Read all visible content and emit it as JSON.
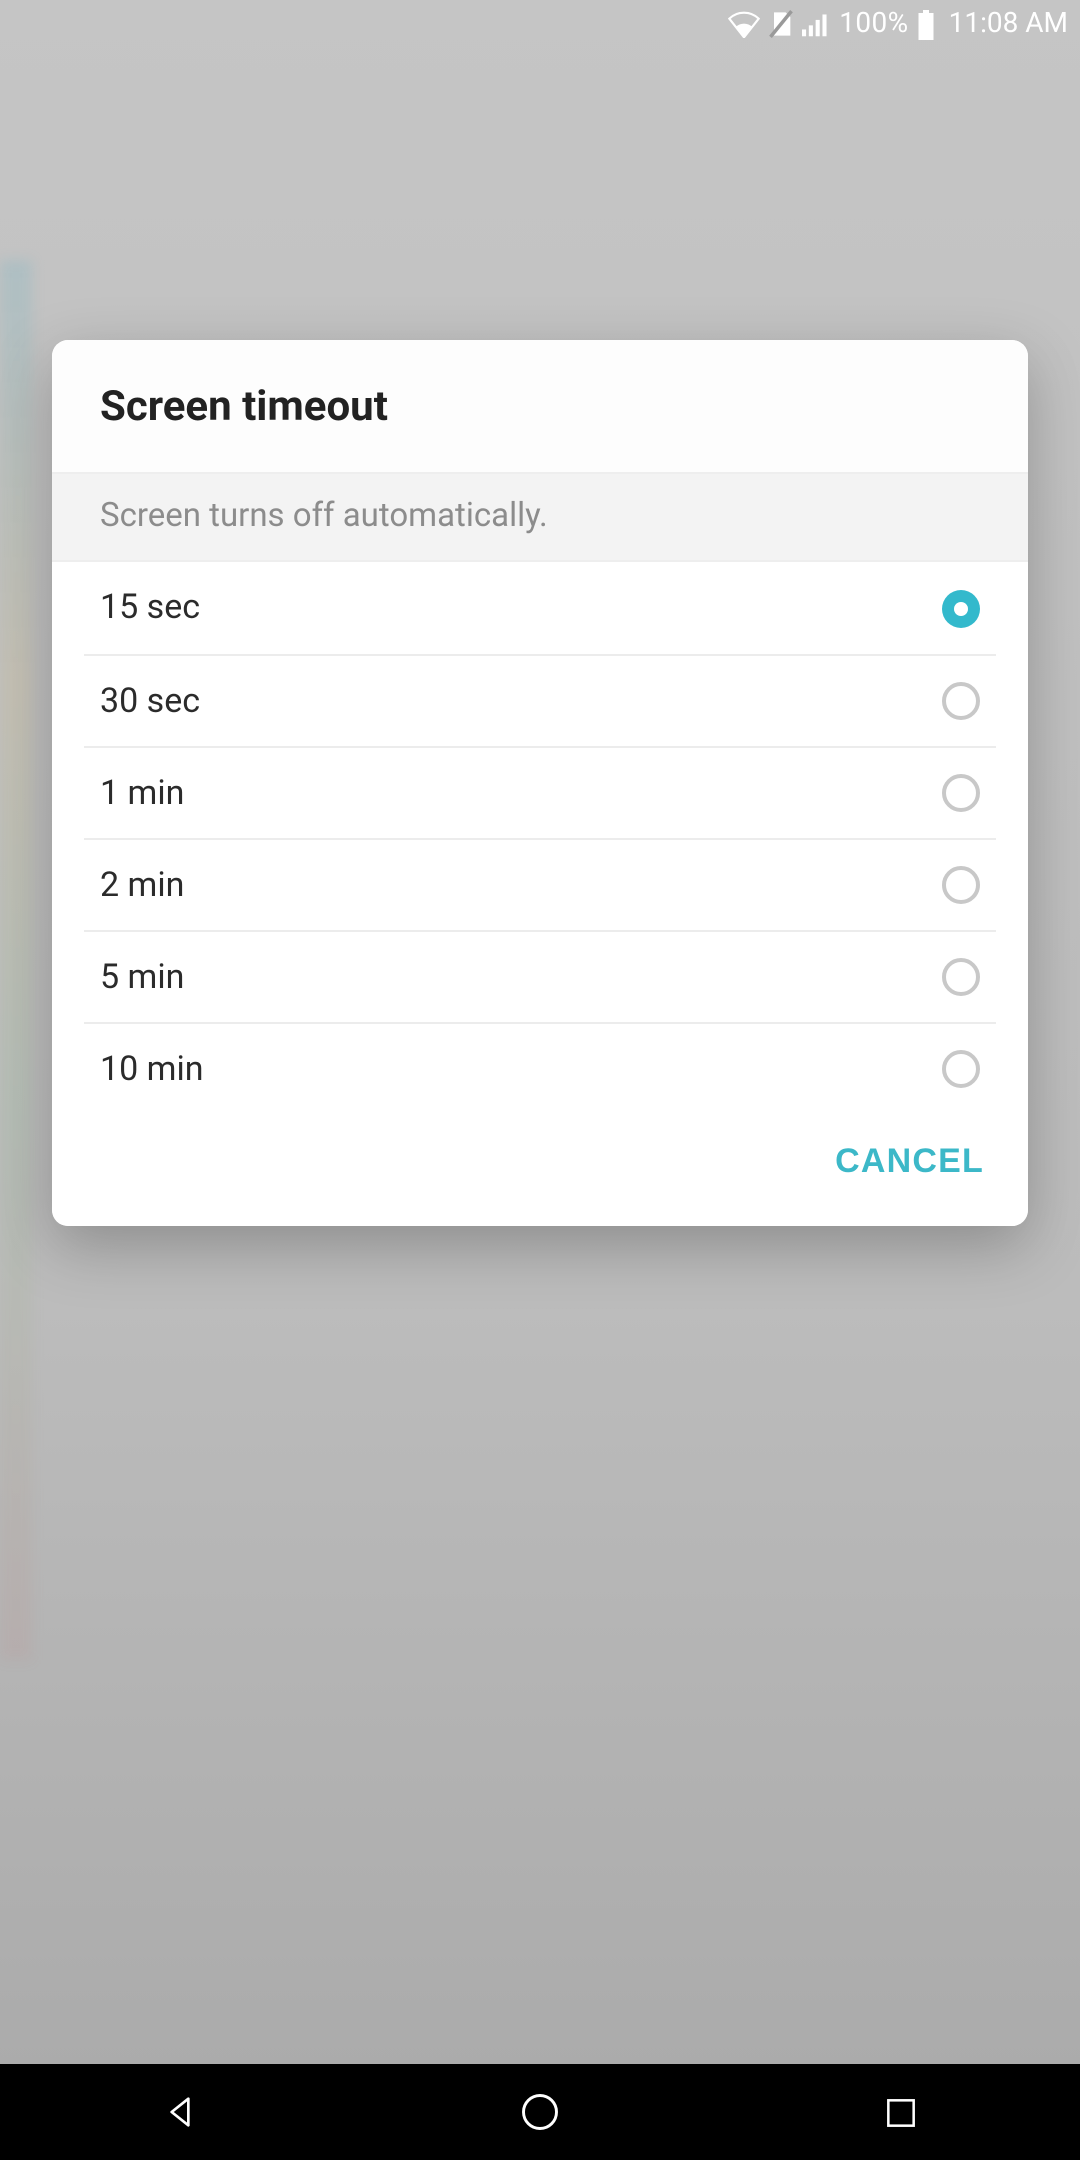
{
  "status_bar": {
    "battery_text": "100%",
    "time": "11:08 AM"
  },
  "dialog": {
    "title": "Screen timeout",
    "description": "Screen turns off automatically.",
    "options": [
      {
        "label": "15 sec",
        "selected": true
      },
      {
        "label": "30 sec",
        "selected": false
      },
      {
        "label": "1 min",
        "selected": false
      },
      {
        "label": "2 min",
        "selected": false
      },
      {
        "label": "5 min",
        "selected": false
      },
      {
        "label": "10 min",
        "selected": false
      }
    ],
    "cancel_label": "CANCEL"
  }
}
